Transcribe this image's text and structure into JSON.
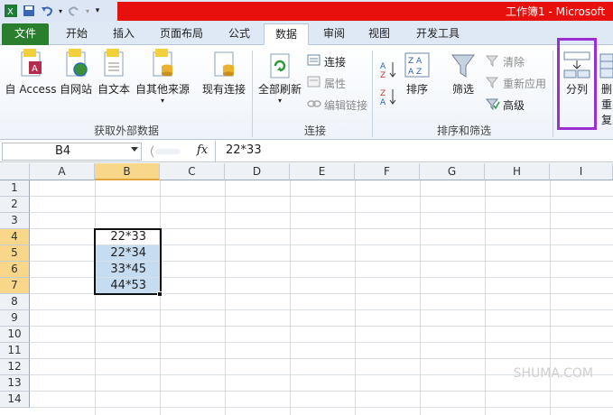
{
  "title_bar": {
    "window_title": "工作簿1 - Microsoft"
  },
  "qat": {
    "excel_icon": "excel-icon",
    "save_icon": "save-icon",
    "undo_icon": "undo-icon",
    "redo_icon": "redo-icon",
    "customize_icon": "customize-icon"
  },
  "tabs": [
    {
      "label": "文件"
    },
    {
      "label": "开始"
    },
    {
      "label": "插入"
    },
    {
      "label": "页面布局"
    },
    {
      "label": "公式"
    },
    {
      "label": "数据"
    },
    {
      "label": "审阅"
    },
    {
      "label": "视图"
    },
    {
      "label": "开发工具"
    }
  ],
  "active_tab": "数据",
  "ribbon": {
    "get_external": {
      "group_name": "获取外部数据",
      "from_access": "自 Access",
      "from_web": "自网站",
      "from_text": "自文本",
      "from_other": "自其他来源",
      "existing": "现有连接"
    },
    "connections": {
      "group_name": "连接",
      "refresh_all": "全部刷新",
      "connections": "连接",
      "properties": "属性",
      "edit_links": "编辑链接"
    },
    "sort_filter": {
      "group_name": "排序和筛选",
      "sort": "排序",
      "filter": "筛选",
      "clear": "清除",
      "reapply": "重新应用",
      "advanced": "高级"
    },
    "data_tools": {
      "text_to_columns": "分列",
      "remove_dup_top": "删",
      "remove_dup_bottom": "重复"
    }
  },
  "formula_bar": {
    "name_box": "B4",
    "fx": "fx",
    "value": "22*33"
  },
  "columns": [
    "A",
    "B",
    "C",
    "D",
    "E",
    "F",
    "G",
    "H",
    "I"
  ],
  "rows": [
    "1",
    "2",
    "3",
    "4",
    "5",
    "6",
    "7",
    "8",
    "9",
    "10",
    "11",
    "12",
    "13",
    "14"
  ],
  "cells": {
    "B4": "22*33",
    "B5": "22*34",
    "B6": "33*45",
    "B7": "44*53"
  },
  "selected_column": "B",
  "selected_rows": [
    "4",
    "5",
    "6",
    "7"
  ],
  "watermark": "SHUMA.COM",
  "colors": {
    "title_red": "#e8100c",
    "file_tab": "#2a7f2f",
    "highlight": "#9b2ed1",
    "selection_fill": "#c6dcf1"
  }
}
